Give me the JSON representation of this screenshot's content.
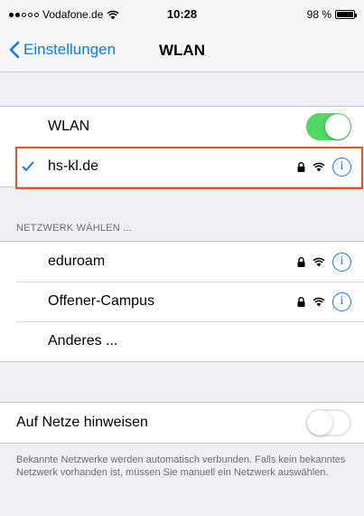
{
  "status_bar": {
    "carrier": "Vodafone.de",
    "time": "10:28",
    "battery_text": "98 %",
    "battery_level": 0.98
  },
  "nav": {
    "back_label": "Einstellungen",
    "title": "WLAN"
  },
  "wlan": {
    "label": "WLAN",
    "enabled": true,
    "connected_network": "hs-kl.de"
  },
  "networks": {
    "header": "NETZWERK WÄHLEN ...",
    "items": [
      {
        "name": "eduroam"
      },
      {
        "name": "Offener-Campus"
      }
    ],
    "other_label": "Anderes ..."
  },
  "ask_to_join": {
    "label": "Auf Netze hinweisen",
    "enabled": false,
    "footer": "Bekannte Netzwerke werden automatisch verbunden. Falls kein bekanntes Netzwerk vorhanden ist, müssen Sie manuell ein Netzwerk auswählen."
  },
  "colors": {
    "accent": "#0a7aff",
    "toggle_on": "#4cd964",
    "highlight": "#e8531f"
  },
  "icons": [
    "signal-dots-icon",
    "wifi-icon",
    "battery-icon",
    "back-chevron-icon",
    "checkmark-icon",
    "lock-icon",
    "info-icon"
  ]
}
